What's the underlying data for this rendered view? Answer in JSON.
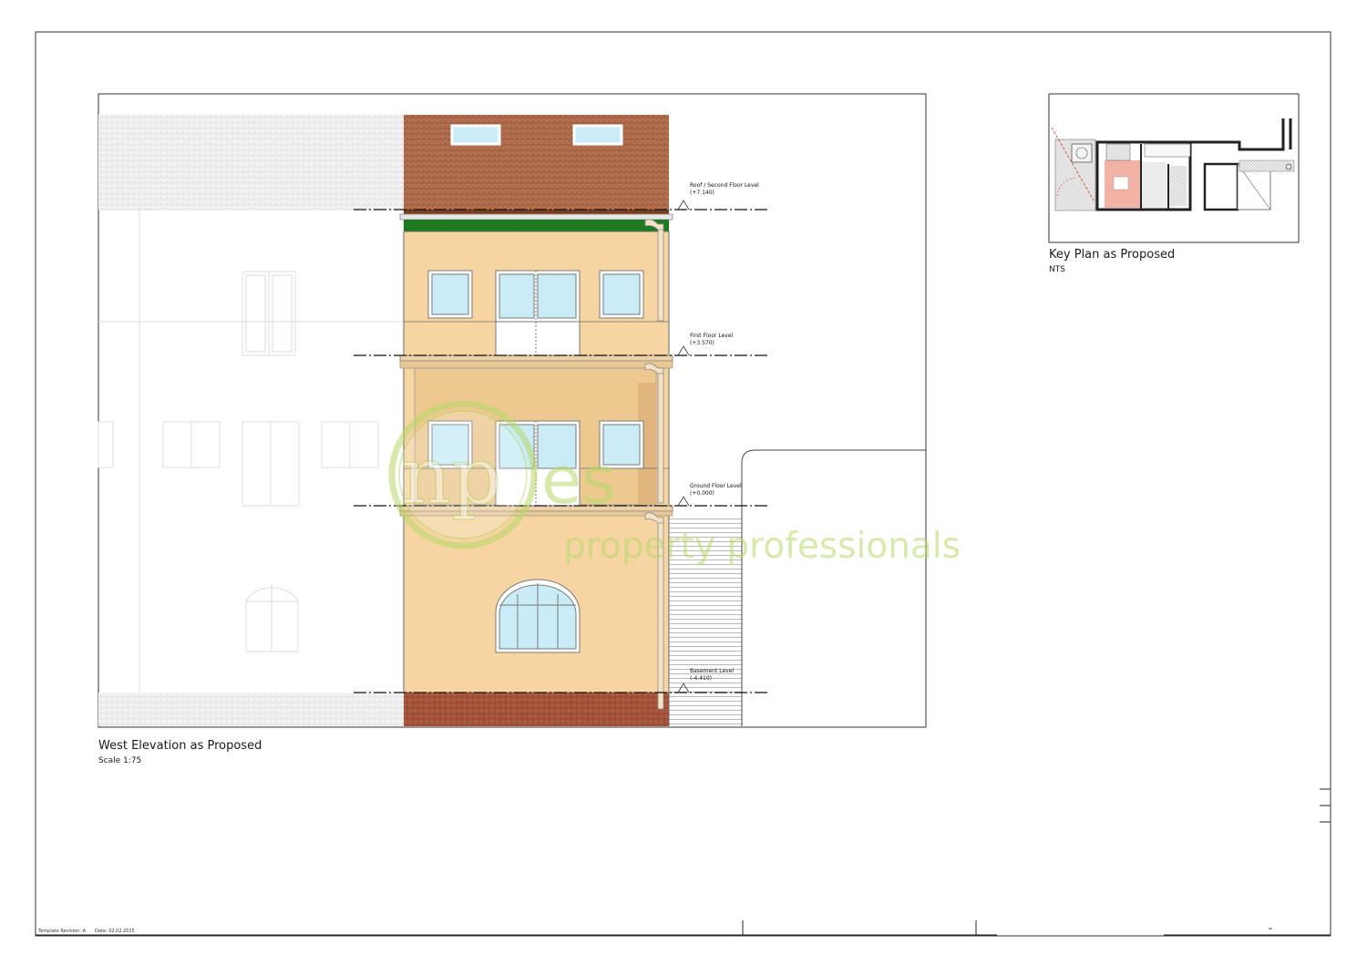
{
  "elevation": {
    "title": "West Elevation as Proposed",
    "scale": "Scale 1:75"
  },
  "key_plan": {
    "title": "Key Plan as Proposed",
    "scale": "NTS"
  },
  "levels": [
    {
      "name": "Roof / Second Floor Level",
      "value": "(+7.140)"
    },
    {
      "name": "First Floor Level",
      "value": "(+3.570)"
    },
    {
      "name": "Ground Floor Level",
      "value": "(+0.000)"
    },
    {
      "name": "Basement Level",
      "value": "(-4.410)"
    }
  ],
  "watermark": {
    "monogram": "np",
    "tail": "es",
    "tagline": "property professionals"
  },
  "footer": {
    "template_revision": "Template Revision: A",
    "date": "Date: 02.02.2015"
  },
  "colors": {
    "render": "#f6d5a2",
    "roof_tile": "#b06a4a",
    "paving": "#a9563c",
    "green_roof_edge": "#1f7a22",
    "glass": "#c9ecf6",
    "watermark": "#b7d86a"
  }
}
